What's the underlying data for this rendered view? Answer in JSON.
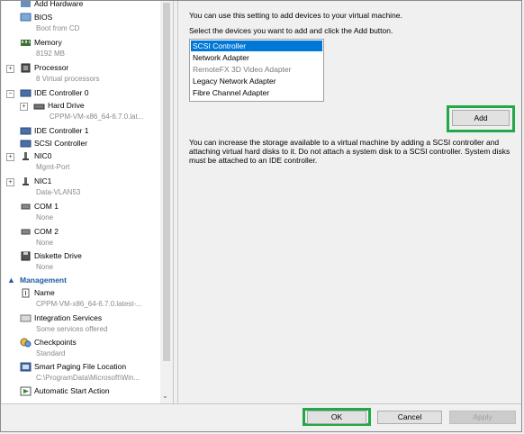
{
  "tree": {
    "items": [
      {
        "label": "Add Hardware",
        "sub": "",
        "icon": "add-hardware-icon"
      },
      {
        "label": "BIOS",
        "sub": "Boot from CD",
        "icon": "bios-icon"
      },
      {
        "label": "Memory",
        "sub": "8192 MB",
        "icon": "memory-icon"
      },
      {
        "label": "Processor",
        "sub": "8 Virtual processors",
        "icon": "processor-icon"
      },
      {
        "label": "IDE Controller 0",
        "sub": "",
        "icon": "ide-controller-icon"
      },
      {
        "label": "Hard Drive",
        "sub": "CPPM-VM-x86_64-6.7.0.lat...",
        "icon": "hard-drive-icon"
      },
      {
        "label": "IDE Controller 1",
        "sub": "",
        "icon": "ide-controller-icon"
      },
      {
        "label": "SCSI Controller",
        "sub": "",
        "icon": "scsi-controller-icon"
      },
      {
        "label": "NIC0",
        "sub": "Mgmt-Port",
        "icon": "network-adapter-icon"
      },
      {
        "label": "NIC1",
        "sub": "Data-VLAN53",
        "icon": "network-adapter-icon"
      },
      {
        "label": "COM 1",
        "sub": "None",
        "icon": "com-port-icon"
      },
      {
        "label": "COM 2",
        "sub": "None",
        "icon": "com-port-icon"
      },
      {
        "label": "Diskette Drive",
        "sub": "None",
        "icon": "diskette-icon"
      }
    ],
    "management_header": "Management",
    "management_items": [
      {
        "label": "Name",
        "sub": "CPPM-VM-x86_64-6.7.0.latest-...",
        "icon": "name-icon"
      },
      {
        "label": "Integration Services",
        "sub": "Some services offered",
        "icon": "integration-services-icon"
      },
      {
        "label": "Checkpoints",
        "sub": "Standard",
        "icon": "checkpoints-icon"
      },
      {
        "label": "Smart Paging File Location",
        "sub": "C:\\ProgramData\\Microsoft\\Win...",
        "icon": "paging-file-icon"
      },
      {
        "label": "Automatic Start Action",
        "sub": "",
        "icon": "start-action-icon"
      }
    ]
  },
  "right": {
    "intro": "You can use this setting to add devices to your virtual machine.",
    "instruction": "Select the devices you want to add and click the Add button.",
    "devices": [
      {
        "label": "SCSI Controller",
        "state": "selected"
      },
      {
        "label": "Network Adapter",
        "state": "normal"
      },
      {
        "label": "RemoteFX 3D Video Adapter",
        "state": "disabled"
      },
      {
        "label": "Legacy Network Adapter",
        "state": "normal"
      },
      {
        "label": "Fibre Channel Adapter",
        "state": "normal"
      }
    ],
    "add_label": "Add",
    "paragraph": "You can increase the storage available to a virtual machine by adding a SCSI controller and attaching virtual hard disks to it. Do not attach a system disk to a SCSI controller. System disks must be attached to an IDE controller."
  },
  "footer": {
    "ok_label": "OK",
    "cancel_label": "Cancel",
    "apply_label": "Apply"
  },
  "colors": {
    "highlight_box": "#22a84a",
    "selection": "#0078d7",
    "section_header": "#1f5aa6"
  }
}
